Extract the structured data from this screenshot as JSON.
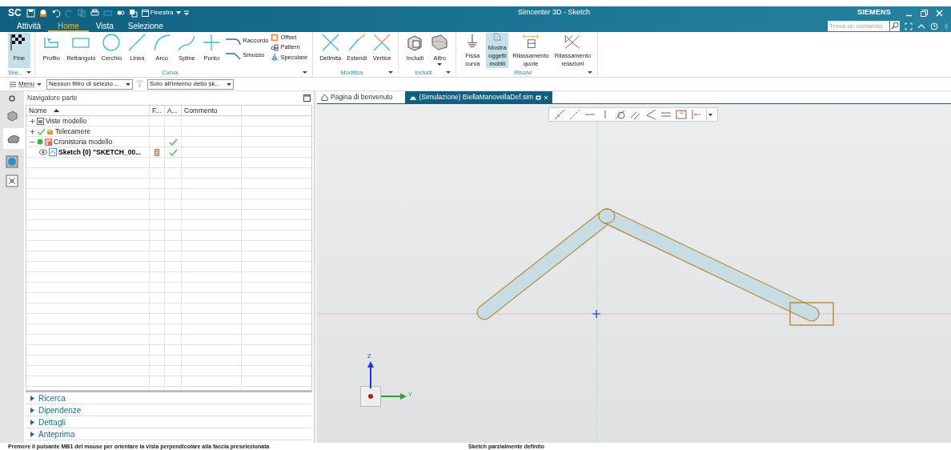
{
  "app": {
    "logo": "SC",
    "window_menu": "Finestra",
    "title": "Simcenter 3D - Sketch",
    "brand": "SIEMENS",
    "search": {
      "placeholder": "Trova un comando"
    }
  },
  "tabs": [
    {
      "label": "Attività",
      "selected": false
    },
    {
      "label": "Home",
      "selected": true
    },
    {
      "label": "Vista",
      "selected": false
    },
    {
      "label": "Selezione",
      "selected": false
    }
  ],
  "ribbon": {
    "groups": [
      {
        "label": "Ske...",
        "tools": [
          {
            "label": "Fine",
            "kind": "large",
            "selected": true
          }
        ]
      },
      {
        "label": "Curva",
        "tools": [
          {
            "label": "Profilo",
            "kind": "large",
            "selected": false
          },
          {
            "label": "Rettangolo",
            "kind": "large",
            "selected": false
          },
          {
            "label": "Cerchio",
            "kind": "large",
            "selected": false
          },
          {
            "label": "Linea",
            "kind": "large",
            "selected": false
          },
          {
            "label": "Arco",
            "kind": "large",
            "selected": false
          },
          {
            "label": "Spline",
            "kind": "large",
            "selected": false
          },
          {
            "label": "Punto",
            "kind": "large",
            "selected": false
          },
          {
            "label": "Raccordo",
            "kind": "medium",
            "selected": false
          },
          {
            "label": "Smusso",
            "kind": "medium",
            "selected": false
          },
          {
            "label": "Offset",
            "kind": "small",
            "selected": false
          },
          {
            "label": "Pattern",
            "kind": "small",
            "selected": false
          },
          {
            "label": "Speculare",
            "kind": "small",
            "selected": false
          }
        ]
      },
      {
        "label": "Modifica",
        "tools": [
          {
            "label": "Delimita",
            "kind": "large",
            "selected": false
          },
          {
            "label": "Estendi",
            "kind": "large",
            "selected": false
          },
          {
            "label": "Vertice",
            "kind": "large",
            "selected": false
          }
        ]
      },
      {
        "label": "Includi",
        "tools": [
          {
            "label": "Includi",
            "kind": "large",
            "selected": false
          },
          {
            "label": "Altro",
            "kind": "large",
            "selected": false
          }
        ]
      },
      {
        "label": "Risolvi",
        "tools": [
          {
            "label": "Fissa curva",
            "kind": "large",
            "selected": false
          },
          {
            "label": "Mostra oggetti mobili",
            "kind": "large",
            "selected": true
          },
          {
            "label": "Rilassamento quote",
            "kind": "large",
            "selected": false
          },
          {
            "label": "Rilassamento relazioni",
            "kind": "large",
            "selected": false
          }
        ]
      }
    ]
  },
  "command_bar": {
    "menu": "Menu",
    "filters": [
      "Nessun filtro di selezio...",
      "Solo all'interno dello sk..."
    ]
  },
  "navigator": {
    "title": "Navigatore parte",
    "columns": [
      "Nome",
      "F...",
      "A...",
      "Commento"
    ],
    "rows": [
      {
        "name": "Viste modello",
        "expanded": false,
        "checked": false,
        "a_checked": false,
        "current": false
      },
      {
        "name": "Telecamere",
        "expanded": false,
        "checked": true,
        "a_checked": false,
        "current": false
      },
      {
        "name": "Cronistoria modello",
        "expanded": true,
        "checked": false,
        "a_checked": true,
        "current": false,
        "children": [
          {
            "name": "Sketch (0) \"SKETCH_00...",
            "checked": false,
            "a_checked": true,
            "current": true
          }
        ]
      }
    ],
    "panels": [
      {
        "label": "Ricerca",
        "expanded": false
      },
      {
        "label": "Dipendenze",
        "expanded": false
      },
      {
        "label": "Dettagli",
        "expanded": false
      },
      {
        "label": "Anteprima",
        "expanded": false
      }
    ]
  },
  "doc_tabs": [
    {
      "label": "Pagina di benvenuto",
      "selected": false
    },
    {
      "label": "(Simulazione) BiellaManovellaDef.sim",
      "selected": true
    }
  ],
  "viewport": {
    "axes": {
      "z": "Z",
      "y": "Y"
    }
  },
  "status_bar": {
    "message": "Premere il pulsante MB1 del mouse per orientare la vista perpendicolare alla faccia preselezionata",
    "sketch_status": "Sketch parzialmente definito"
  }
}
